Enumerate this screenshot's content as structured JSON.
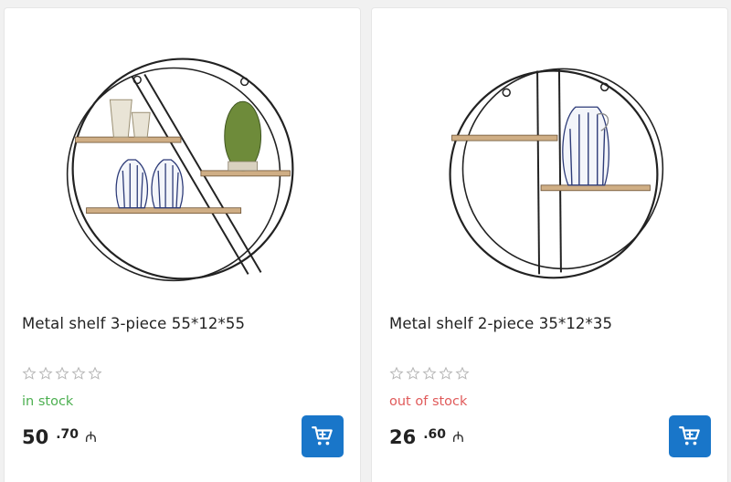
{
  "products": [
    {
      "title": "Metal shelf 3-piece 55*12*55",
      "stock_text": "in stock",
      "stock_status": "in",
      "price_int": "50",
      "price_dec": ".70",
      "currency": "₼",
      "rating": 0,
      "rating_max": 5,
      "image_icon": "round-metal-shelf-3-piece"
    },
    {
      "title": "Metal shelf 2-piece 35*12*35",
      "stock_text": "out of stock",
      "stock_status": "out",
      "price_int": "26",
      "price_dec": ".60",
      "currency": "₼",
      "rating": 0,
      "rating_max": 5,
      "image_icon": "round-metal-shelf-2-piece"
    }
  ],
  "colors": {
    "cart_button": "#1976c9",
    "in_stock": "#4caf50",
    "out_of_stock": "#e05a5a"
  }
}
